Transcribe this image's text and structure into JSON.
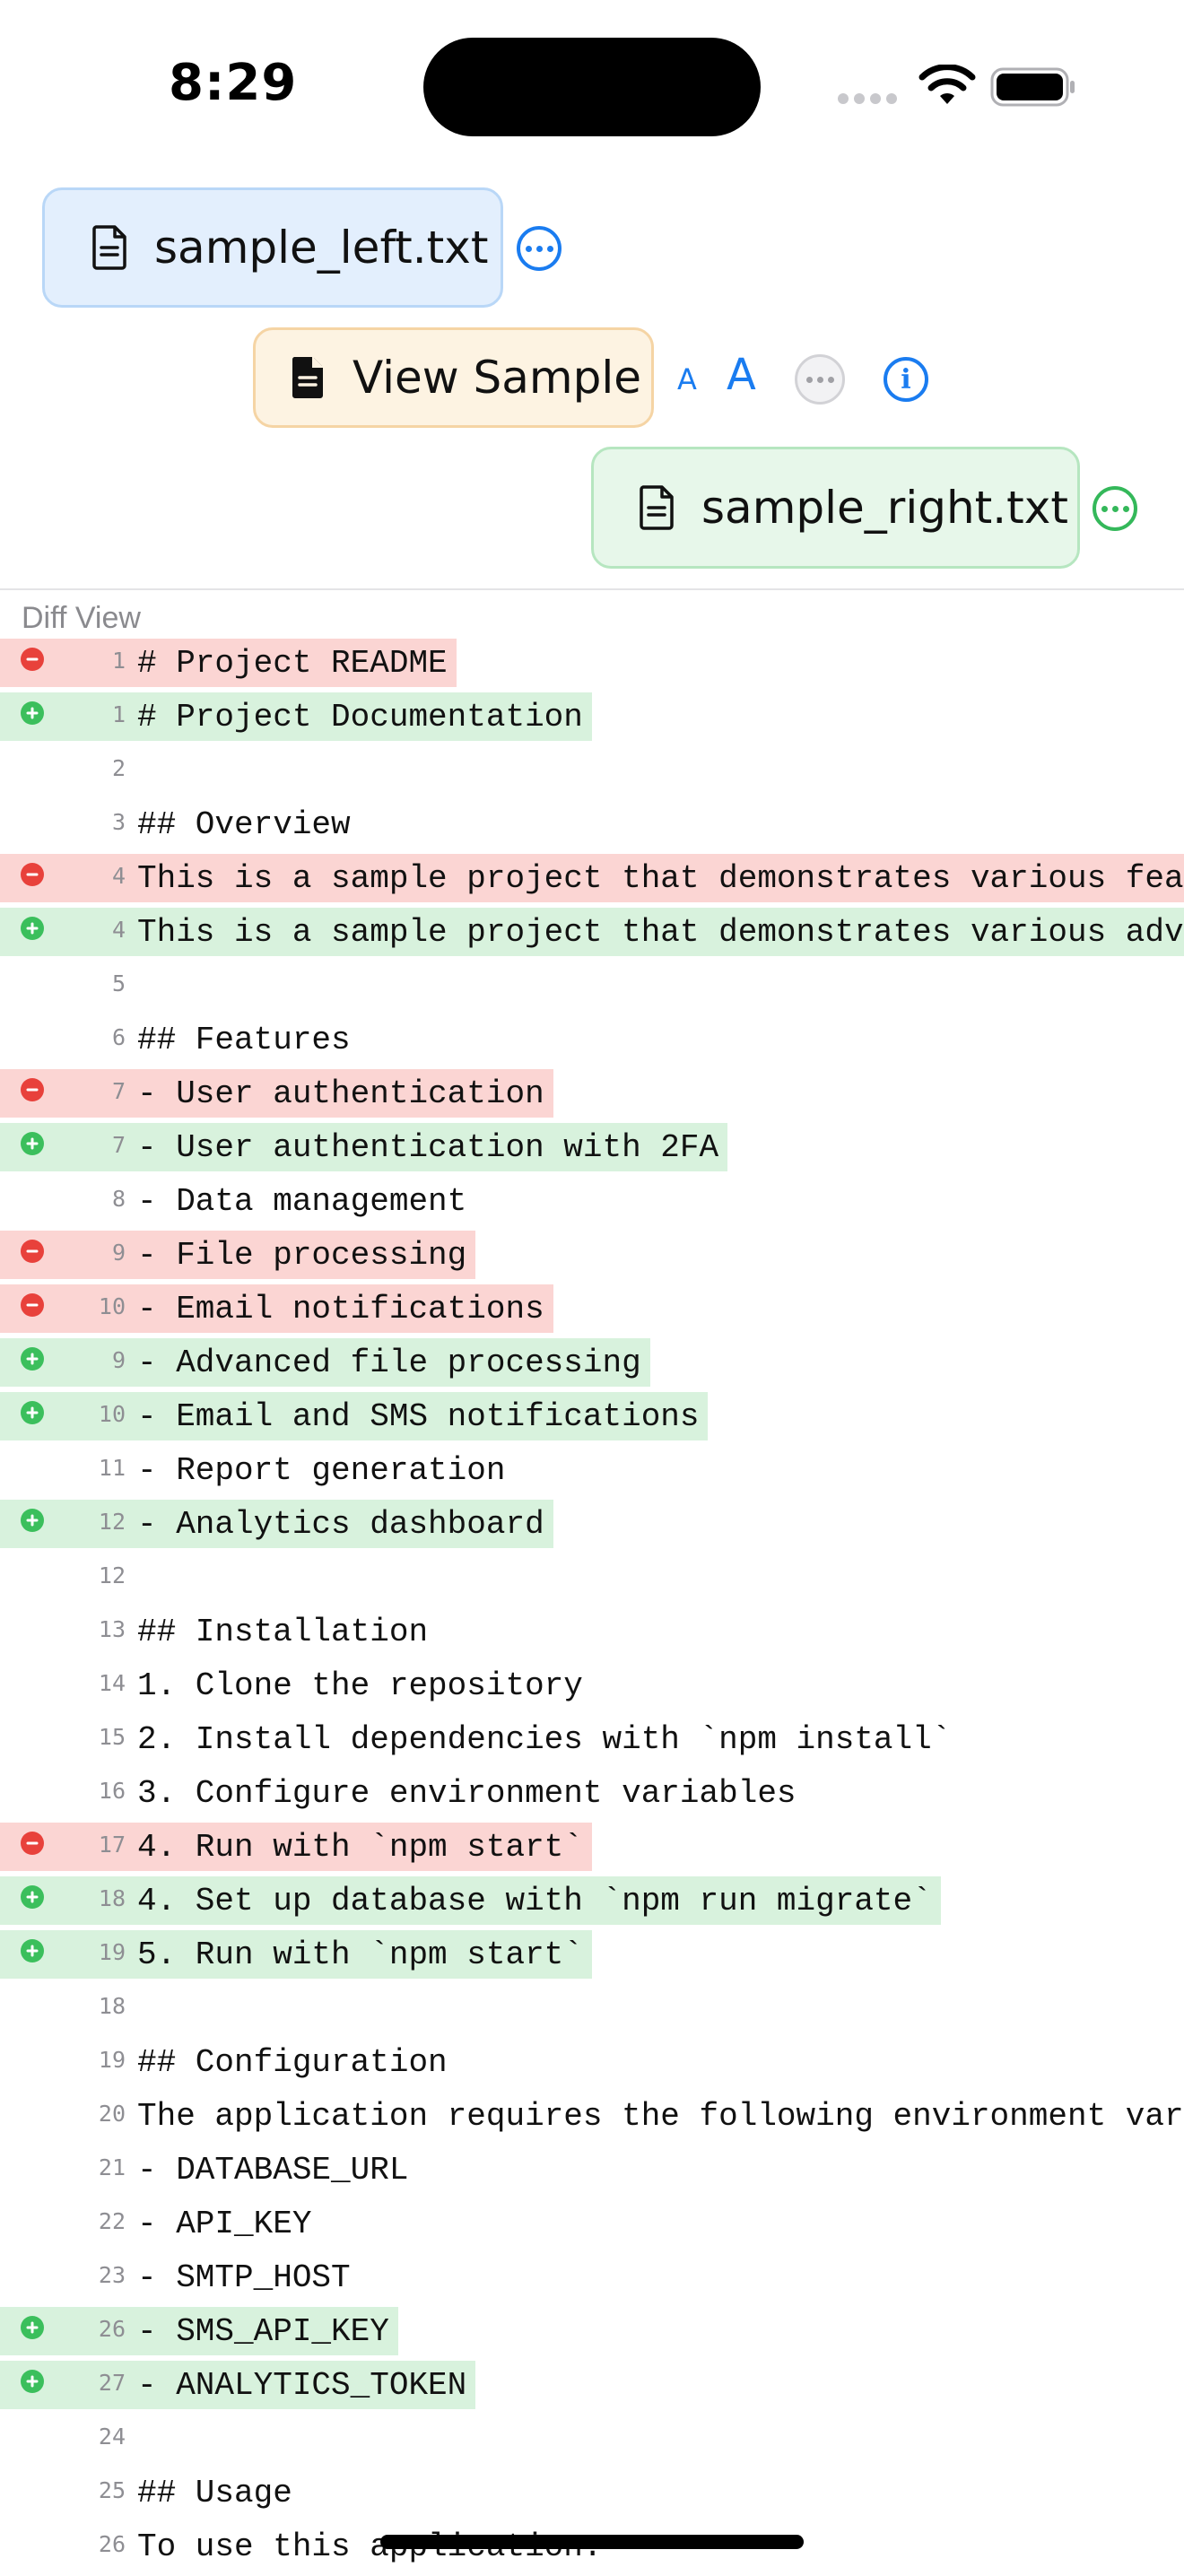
{
  "status": {
    "time": "8:29"
  },
  "toolbar": {
    "left_file": "sample_left.txt",
    "center_label": "View Sample",
    "right_file": "sample_right.txt",
    "font_small": "A",
    "font_large": "A",
    "info_glyph": "i"
  },
  "colors": {
    "accent_blue": "#1a7cf0",
    "accent_green": "#34b85a",
    "removed_bg": "#fbd5d3",
    "added_bg": "#d8f2dd"
  },
  "icons": [
    "document-icon",
    "more-icon",
    "info-icon",
    "wifi-icon",
    "battery-icon",
    "signal-icon"
  ],
  "diff_view": {
    "title": "Diff View",
    "lines": [
      {
        "type": "removed",
        "num": "1",
        "text": "# Project README"
      },
      {
        "type": "added",
        "num": "1",
        "text": "# Project Documentation"
      },
      {
        "type": "context",
        "num": "2",
        "text": ""
      },
      {
        "type": "context",
        "num": "3",
        "text": "## Overview"
      },
      {
        "type": "removed",
        "num": "4",
        "text": "This is a sample project that demonstrates various features."
      },
      {
        "type": "added",
        "num": "4",
        "text": "This is a sample project that demonstrates various advanced features."
      },
      {
        "type": "context",
        "num": "5",
        "text": ""
      },
      {
        "type": "context",
        "num": "6",
        "text": "## Features"
      },
      {
        "type": "removed",
        "num": "7",
        "text": "- User authentication"
      },
      {
        "type": "added",
        "num": "7",
        "text": "- User authentication with 2FA"
      },
      {
        "type": "context",
        "num": "8",
        "text": "- Data management"
      },
      {
        "type": "removed",
        "num": "9",
        "text": "- File processing"
      },
      {
        "type": "removed",
        "num": "10",
        "text": "- Email notifications"
      },
      {
        "type": "added",
        "num": "9",
        "text": "- Advanced file processing"
      },
      {
        "type": "added",
        "num": "10",
        "text": "- Email and SMS notifications"
      },
      {
        "type": "context",
        "num": "11",
        "text": "- Report generation"
      },
      {
        "type": "added",
        "num": "12",
        "text": "- Analytics dashboard"
      },
      {
        "type": "context",
        "num": "12",
        "text": ""
      },
      {
        "type": "context",
        "num": "13",
        "text": "## Installation"
      },
      {
        "type": "context",
        "num": "14",
        "text": "1. Clone the repository"
      },
      {
        "type": "context",
        "num": "15",
        "text": "2. Install dependencies with `npm install`"
      },
      {
        "type": "context",
        "num": "16",
        "text": "3. Configure environment variables"
      },
      {
        "type": "removed",
        "num": "17",
        "text": "4. Run with `npm start`"
      },
      {
        "type": "added",
        "num": "18",
        "text": "4. Set up database with `npm run migrate`"
      },
      {
        "type": "added",
        "num": "19",
        "text": "5. Run with `npm start`"
      },
      {
        "type": "context",
        "num": "18",
        "text": ""
      },
      {
        "type": "context",
        "num": "19",
        "text": "## Configuration"
      },
      {
        "type": "context",
        "num": "20",
        "text": "The application requires the following environment variables:"
      },
      {
        "type": "context",
        "num": "21",
        "text": "- DATABASE_URL"
      },
      {
        "type": "context",
        "num": "22",
        "text": "- API_KEY"
      },
      {
        "type": "context",
        "num": "23",
        "text": "- SMTP_HOST"
      },
      {
        "type": "added",
        "num": "26",
        "text": "- SMS_API_KEY"
      },
      {
        "type": "added",
        "num": "27",
        "text": "- ANALYTICS_TOKEN"
      },
      {
        "type": "context",
        "num": "24",
        "text": ""
      },
      {
        "type": "context",
        "num": "25",
        "text": "## Usage"
      },
      {
        "type": "context",
        "num": "26",
        "text": "To use this application:"
      }
    ]
  }
}
